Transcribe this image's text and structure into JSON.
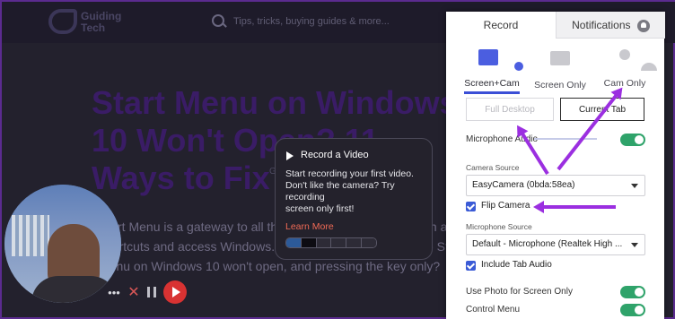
{
  "background_site": {
    "logo_text": "Guiding\nTech",
    "search_placeholder": "Tips, tricks, buying guides & more...",
    "title": "Start Menu on Windows 10 Won't Open? 11 Ways to Fix",
    "author": "Ga",
    "body": "Start Menu is a gateway to all the installed apps. You can pin app shortcuts and access Windows. But what happens when the Start Menu on Windows 10 won't open, and pressing the key only?"
  },
  "tooltip": {
    "title": "Record a Video",
    "text": "Start recording your first video.\nDon't like the camera? Try recording\nscreen only first!",
    "link": "Learn More",
    "progress_step": 2,
    "progress_total": 6
  },
  "recorder_controls": {
    "more": "•••",
    "close": "✕"
  },
  "panel": {
    "tabs": {
      "record": "Record",
      "notifications": "Notifications"
    },
    "modes": [
      {
        "label": "Screen+Cam",
        "icon": "screen-cam-icon",
        "active": true
      },
      {
        "label": "Screen Only",
        "icon": "screen-icon",
        "active": false
      },
      {
        "label": "Cam Only",
        "icon": "camera-icon",
        "active": false
      }
    ],
    "buttons": {
      "full_desktop": "Full Desktop",
      "current": "Current Tab"
    },
    "microphone_audio_label": "Microphone Audio",
    "camera_source_label": "Camera Source",
    "camera_source_value": "EasyCamera (0bda:58ea)",
    "flip_camera_label": "Flip Camera",
    "microphone_source_label": "Microphone Source",
    "microphone_source_value": "Default - Microphone (Realtek High ...",
    "include_tab_audio_label": "Include Tab Audio",
    "use_photo_label": "Use Photo for Screen Only",
    "control_menu_label": "Control Menu"
  },
  "colors": {
    "accent": "#3b4fd6",
    "toggle_on": "#2fa36a",
    "annotation_arrow": "#9b2fe0",
    "record_button": "#d83232"
  }
}
